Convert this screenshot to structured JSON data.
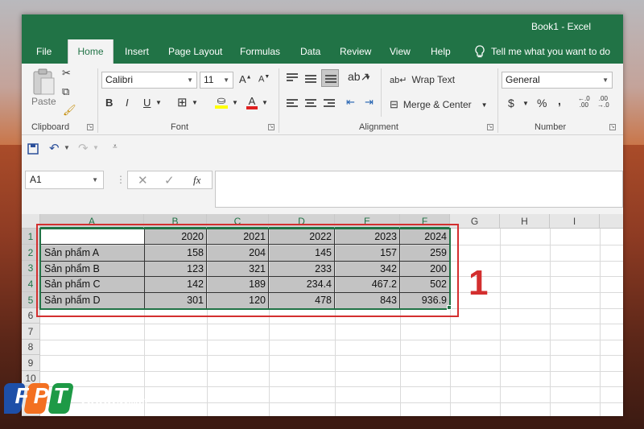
{
  "window": {
    "title": "Book1  -  Excel"
  },
  "tabs": [
    {
      "label": "File"
    },
    {
      "label": "Home"
    },
    {
      "label": "Insert"
    },
    {
      "label": "Page Layout"
    },
    {
      "label": "Formulas"
    },
    {
      "label": "Data"
    },
    {
      "label": "Review"
    },
    {
      "label": "View"
    },
    {
      "label": "Help"
    }
  ],
  "tell_me": "Tell me what you want to do",
  "ribbon": {
    "clipboard": {
      "paste": "Paste",
      "label": "Clipboard"
    },
    "font": {
      "name": "Calibri",
      "size": "11",
      "label": "Font",
      "bold": "B",
      "italic": "I",
      "underline": "U"
    },
    "alignment": {
      "wrap_text": "Wrap Text",
      "merge_center": "Merge & Center",
      "label": "Alignment"
    },
    "number": {
      "format": "General",
      "currency": "$",
      "percent": "%",
      "comma": ",",
      "label": "Number"
    }
  },
  "name_box": "A1",
  "formula_bar": {
    "fx": "fx",
    "value": ""
  },
  "columns": [
    "A",
    "B",
    "C",
    "D",
    "E",
    "F",
    "G",
    "H",
    "I"
  ],
  "rows": [
    "1",
    "2",
    "3",
    "4",
    "5",
    "6",
    "7",
    "8",
    "9",
    "10"
  ],
  "sheet": {
    "header": [
      "",
      "2020",
      "2021",
      "2022",
      "2023",
      "2024"
    ],
    "data": [
      [
        "Sản phẩm A",
        "158",
        "204",
        "145",
        "157",
        "259"
      ],
      [
        "Sản phẩm B",
        "123",
        "321",
        "233",
        "342",
        "200"
      ],
      [
        "Sản phẩm C",
        "142",
        "189",
        "234.4",
        "467.2",
        "502"
      ],
      [
        "Sản phẩm D",
        "301",
        "120",
        "478",
        "843",
        "936.9"
      ]
    ]
  },
  "annotation": {
    "number": "1",
    "color": "#d32f2f"
  },
  "logo": {
    "text": "FPT",
    "suffix": "Shop",
    "domain": ".com.vn"
  },
  "colors": {
    "excel_green": "#217346",
    "selection_fill": "#c3c3c3"
  }
}
